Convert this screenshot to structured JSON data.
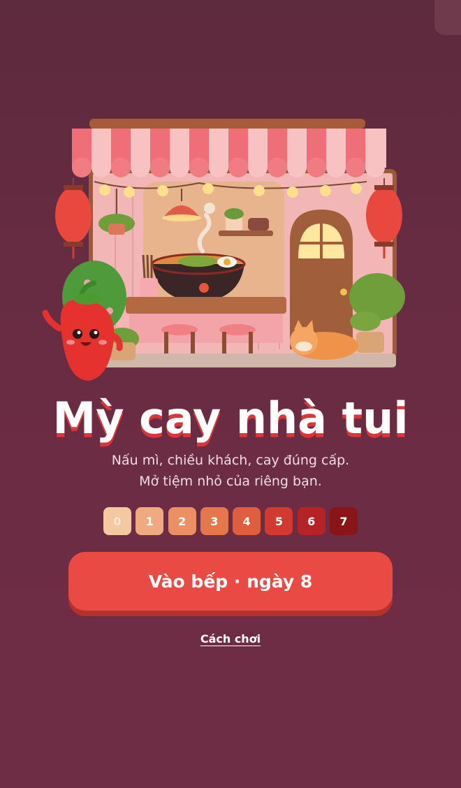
{
  "title": "Mỳ cay nhà tui",
  "subtitle_line1": "Nấu mì, chiều khách, cay đúng cấp.",
  "subtitle_line2": "Mở tiệm nhỏ của riêng bạn.",
  "spice_levels": [
    {
      "label": "0",
      "color": "#f2c9a1"
    },
    {
      "label": "1",
      "color": "#efaa82"
    },
    {
      "label": "2",
      "color": "#ea9063"
    },
    {
      "label": "3",
      "color": "#e5774d"
    },
    {
      "label": "4",
      "color": "#de5e3d"
    },
    {
      "label": "5",
      "color": "#d23a31"
    },
    {
      "label": "6",
      "color": "#b52326"
    },
    {
      "label": "7",
      "color": "#8a1518"
    }
  ],
  "start_button": "Vào bếp · ngày 8",
  "howto_link": "Cách chơi",
  "colors": {
    "background": "#652b41",
    "button": "#e94a43",
    "title_shadow": "#d9373b"
  }
}
